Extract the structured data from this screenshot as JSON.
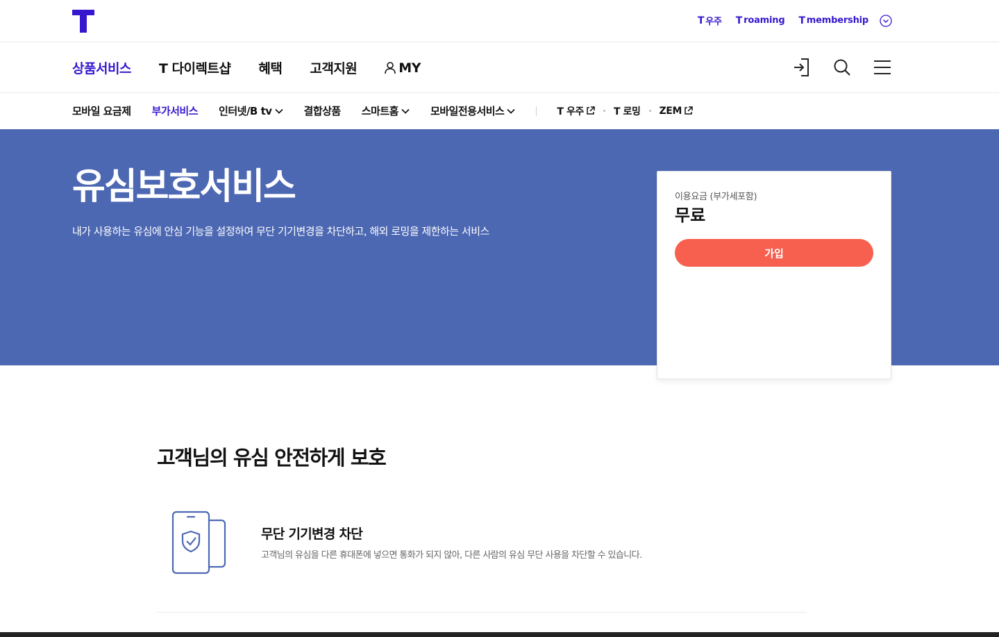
{
  "header": {
    "top_links": [
      {
        "prefix": "T",
        "label": "우주"
      },
      {
        "prefix": "T",
        "label": "roaming"
      },
      {
        "prefix": "T",
        "label": "membership"
      }
    ]
  },
  "main_nav": {
    "items": [
      {
        "label": "상품서비스",
        "active": true
      },
      {
        "label": "T 다이렉트샵",
        "active": false
      },
      {
        "label": "혜택",
        "active": false
      },
      {
        "label": "고객지원",
        "active": false
      },
      {
        "label": "MY",
        "active": false
      }
    ]
  },
  "sub_nav": {
    "items": [
      {
        "label": "모바일 요금제"
      },
      {
        "label": "부가서비스"
      },
      {
        "label": "인터넷/B tv"
      },
      {
        "label": "결합상품"
      },
      {
        "label": "스마트홈"
      },
      {
        "label": "모바일전용서비스"
      }
    ],
    "external": [
      {
        "label": "T 우주"
      },
      {
        "label": "T 로밍"
      },
      {
        "label": "ZEM"
      }
    ]
  },
  "hero": {
    "title": "유심보호서비스",
    "description": "내가 사용하는 유심에 안심 기능을 설정하여 무단 기기변경을 차단하고, 해외 로밍을 제한하는 서비스"
  },
  "price_card": {
    "label": "이용요금 (부가세포함)",
    "value": "무료",
    "join_label": "가입"
  },
  "content": {
    "section_title": "고객님의 유심 안전하게 보호",
    "feature": {
      "title": "무단 기기변경 차단",
      "description": "고객님의 유심을 다른 휴대폰에 넣으면 통화가 되지 않아, 다른 사람의 유심 무단 사용을 차단할 수 있습니다."
    }
  },
  "colors": {
    "brand": "#3617ce",
    "hero_bg": "#4d68b3",
    "join_button": "#f75f4f"
  },
  "icons": [
    "t-logo-icon",
    "chevron-down-circle-icon",
    "person-icon",
    "login-icon",
    "search-icon",
    "menu-icon",
    "chevron-down-icon",
    "external-link-icon",
    "phone-shield-icon"
  ]
}
